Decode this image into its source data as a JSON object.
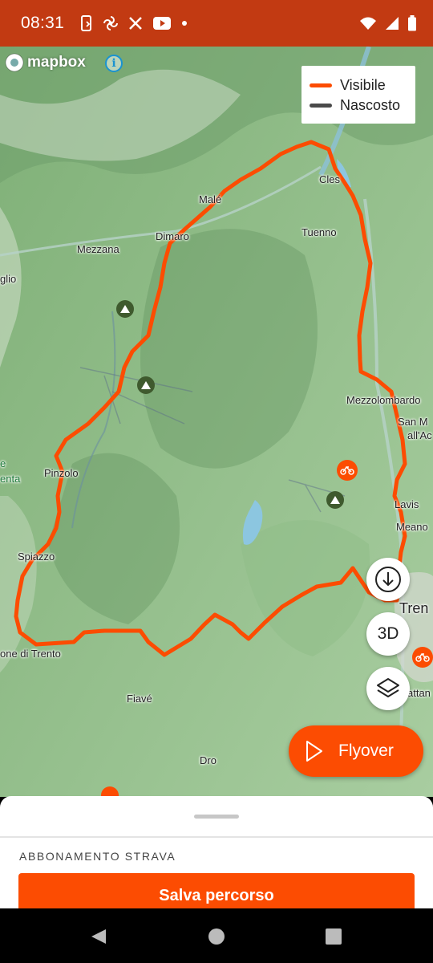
{
  "status_bar": {
    "time": "08:31",
    "notification_icons": [
      "phone-icon",
      "pinwheel-icon",
      "x-icon",
      "youtube-icon",
      "dot-icon"
    ],
    "system_icons": [
      "wifi-icon",
      "signal-icon",
      "battery-icon"
    ]
  },
  "map": {
    "attribution": "mapbox",
    "legend": [
      {
        "label": "Visibile",
        "color": "#fc4c02"
      },
      {
        "label": "Nascosto",
        "color": "#4a4a4a"
      }
    ],
    "places": {
      "cles": "Cles",
      "male": "Malé",
      "tuenno": "Tuenno",
      "mezzana": "Mezzana",
      "dimaro": "Dimaro",
      "glio": "glio",
      "mezzolombardo": "Mezzolombardo",
      "sanm": "San M",
      "allac": "all'Ac",
      "pinzolo": "Pinzolo",
      "e": "e",
      "enta": "enta",
      "lavis": "Lavis",
      "meano": "Meano",
      "spiazzo": "Spiazzo",
      "tren": "Tren",
      "tione": "one di Trento",
      "fiave": "Fiavé",
      "attan": "attan",
      "dro": "Dro"
    },
    "buttons": {
      "three_d": "3D",
      "flyover": "Flyover"
    },
    "route_color": "#fc4c02"
  },
  "sheet": {
    "section_title": "ABBONAMENTO STRAVA",
    "save_label": "Salva percorso"
  }
}
